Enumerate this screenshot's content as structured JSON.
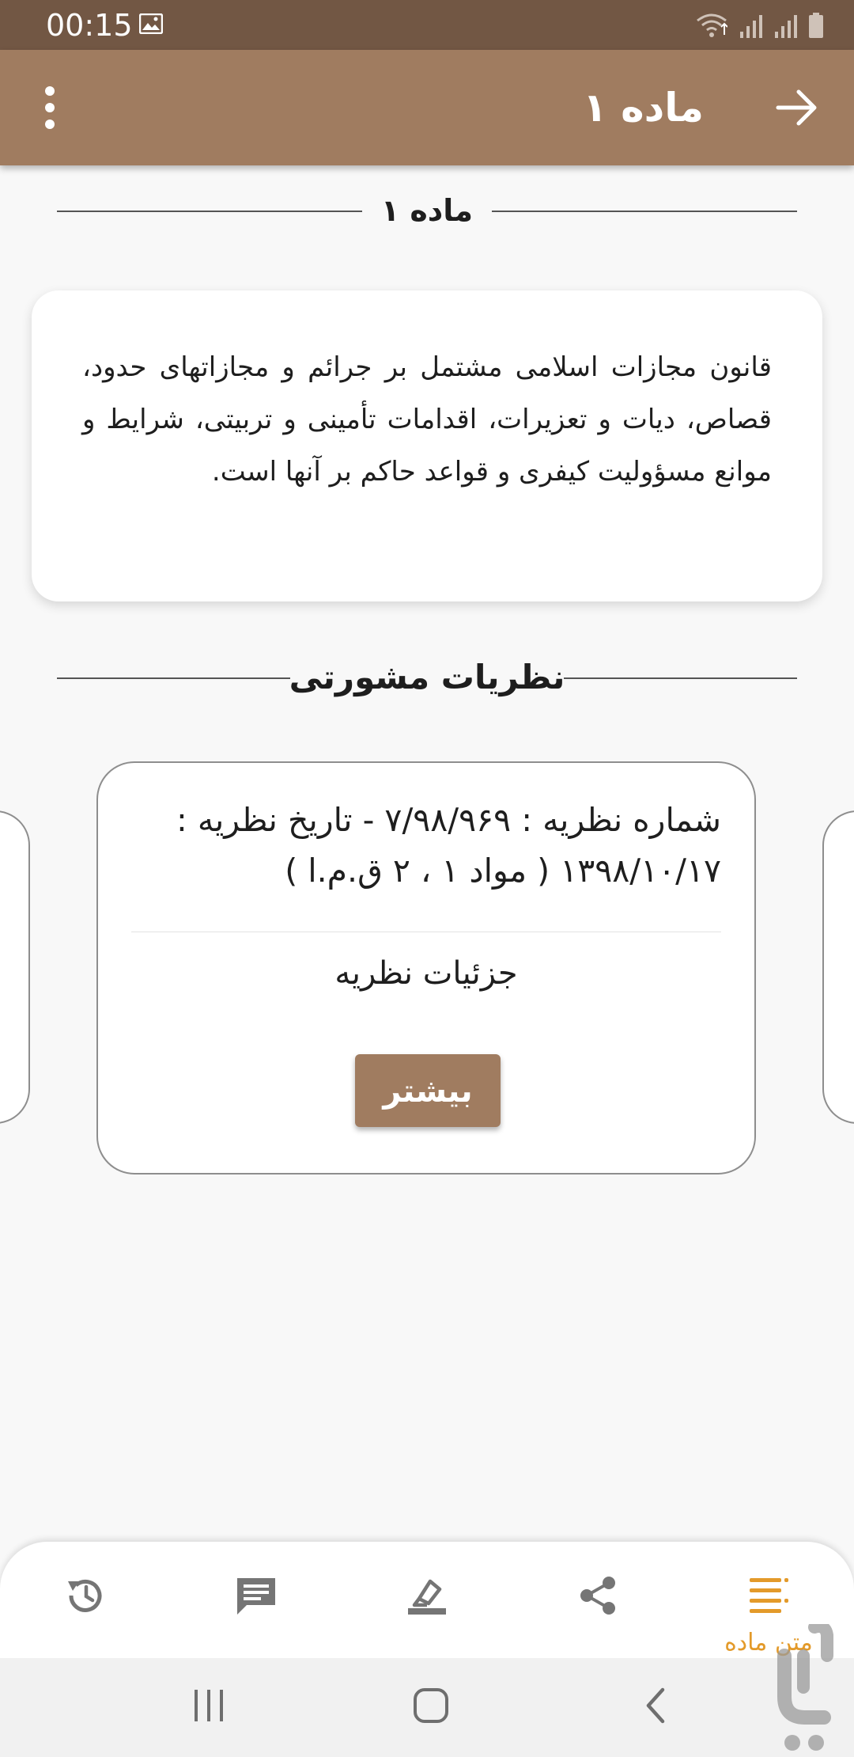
{
  "status_bar": {
    "time": "00:15",
    "icons": [
      "image-icon",
      "wifi-icon",
      "signal-icon",
      "signal-icon",
      "battery-icon"
    ]
  },
  "app_bar": {
    "title": "ماده ۱",
    "back_icon": "arrow-right-icon",
    "menu_icon": "more-vertical-icon"
  },
  "article": {
    "header": "ماده ۱",
    "text": "قانون مجازات اسلامی مشتمل بر جرائم و مجازاتهای حدود، قصاص، دیات و تعزیرات، اقدامات تأمینی و تربیتی، شرایط و موانع مسؤولیت کیفری و قواعد حاکم بر آنها است."
  },
  "opinions": {
    "header": "نظریات مشورتی",
    "card": {
      "title": "شماره نظریه : ۷/۹۸/۹۶۹ - تاریخ نظریه : ۱۳۹۸/۱۰/۱۷ ( مواد ۱ ، ۲ ق.م.ا )",
      "details_label": "جزئیات نظریه",
      "more_label": "بیشتر"
    }
  },
  "bottom_nav": {
    "items": [
      {
        "icon": "history-icon",
        "label": ""
      },
      {
        "icon": "comment-icon",
        "label": ""
      },
      {
        "icon": "highlight-icon",
        "label": ""
      },
      {
        "icon": "share-icon",
        "label": ""
      },
      {
        "icon": "article-text-icon",
        "label": "متن ماده",
        "active": true
      }
    ],
    "active_color": "#e39a2a",
    "inactive_color": "#757575"
  },
  "colors": {
    "status_bar": "#725744",
    "app_bar": "#a07c60",
    "button": "#a07c60",
    "accent": "#e39a2a"
  }
}
